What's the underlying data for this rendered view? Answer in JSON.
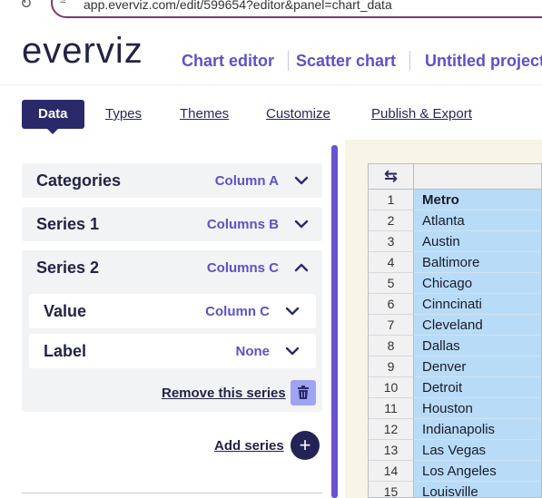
{
  "browser": {
    "url": "app.everviz.com/edit/599654?editor&panel=chart_data"
  },
  "header": {
    "logo": "everviz",
    "nav": [
      "Chart editor",
      "Scatter chart",
      "Untitled project"
    ]
  },
  "tabs": [
    "Data",
    "Types",
    "Themes",
    "Customize",
    "Publish & Export"
  ],
  "mapping": {
    "categories": {
      "label": "Categories",
      "column": "Column A"
    },
    "series1": {
      "label": "Series 1",
      "column": "Columns B"
    },
    "series2": {
      "label": "Series 2",
      "column": "Columns C",
      "value": {
        "label": "Value",
        "column": "Column C"
      },
      "label_field": {
        "label": "Label",
        "column": "None"
      },
      "remove": "Remove this series"
    },
    "add": "Add series"
  },
  "grid": {
    "row_numbers": [
      "1",
      "2",
      "3",
      "4",
      "5",
      "6",
      "7",
      "8",
      "9",
      "10",
      "11",
      "12",
      "13",
      "14",
      "15"
    ],
    "column_a": [
      "Metro",
      "Atlanta",
      "Austin",
      "Baltimore",
      "Chicago",
      "Cinncinati",
      "Cleveland",
      "Dallas",
      "Denver",
      "Detroit",
      "Houston",
      "Indianapolis",
      "Las Vegas",
      "Los Angeles",
      "Louisville"
    ]
  },
  "colors": {
    "accent": "#5b52c9",
    "dark": "#2a2a6a",
    "cell_bg": "#b8dcf8",
    "resizer": "#6a52d0"
  },
  "icons": [
    "reload-icon",
    "site-settings-icon",
    "chevron-down-icon",
    "chevron-up-icon",
    "trash-icon",
    "plus-icon",
    "refresh-icon"
  ]
}
